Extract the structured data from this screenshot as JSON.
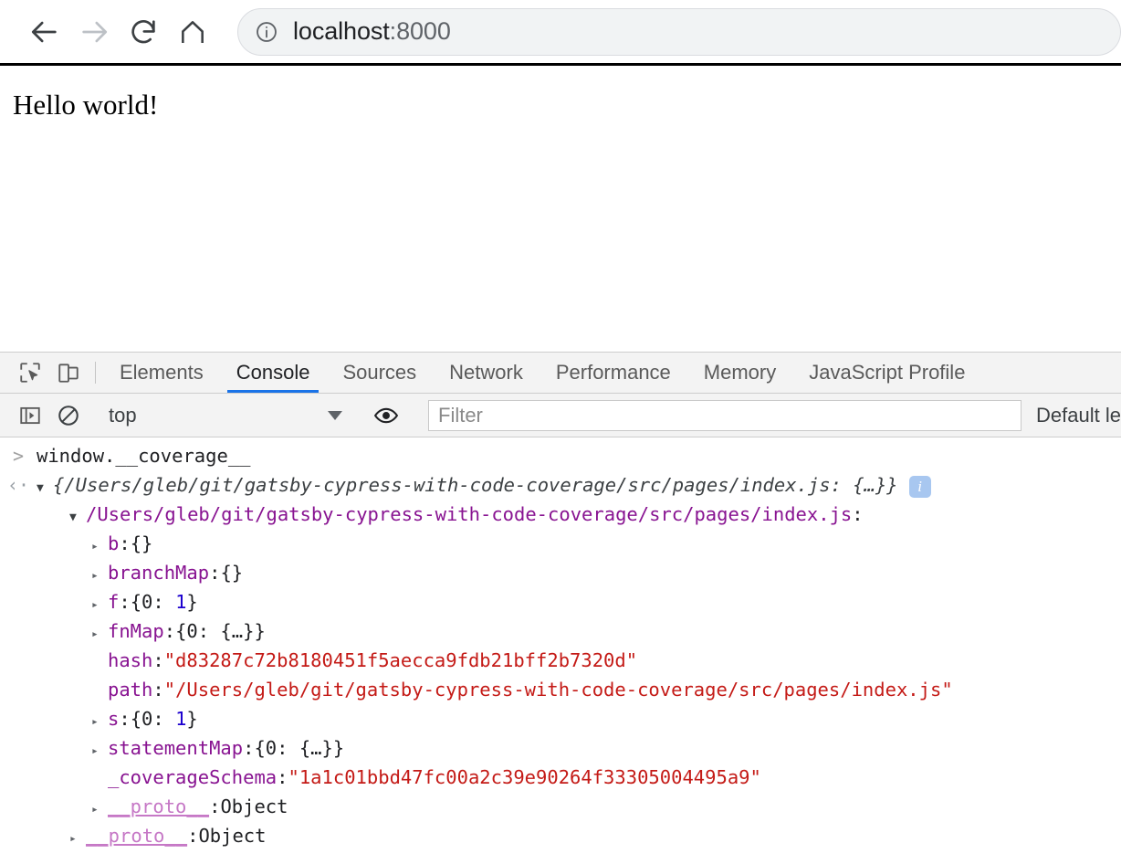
{
  "browser": {
    "nav": {
      "back_icon": "arrow-left-icon",
      "forward_icon": "arrow-right-icon",
      "reload_icon": "reload-icon",
      "home_icon": "home-icon"
    },
    "omnibox": {
      "site_info_icon": "info-circle-icon",
      "url_host": "localhost",
      "url_port": ":8000",
      "value": "localhost:8000"
    }
  },
  "page": {
    "heading": "Hello world!"
  },
  "devtools": {
    "inspect_icon": "inspect-element-icon",
    "device_toolbar_icon": "device-toolbar-icon",
    "tabs": [
      {
        "label": "Elements",
        "active": false
      },
      {
        "label": "Console",
        "active": true
      },
      {
        "label": "Sources",
        "active": false
      },
      {
        "label": "Network",
        "active": false
      },
      {
        "label": "Performance",
        "active": false
      },
      {
        "label": "Memory",
        "active": false
      },
      {
        "label": "JavaScript Profile",
        "active": false
      }
    ],
    "toolbar": {
      "sidebar_icon": "console-sidebar-icon",
      "clear_icon": "clear-console-icon",
      "context": "top",
      "eye_icon": "live-expression-icon",
      "filter_placeholder": "Filter",
      "filter_value": "",
      "levels_label": "Default le"
    },
    "accent_color": "#1a73e8",
    "console": {
      "prompt_symbol": ">",
      "output_symbol": "‹·",
      "input_expression": "window.__coverage__",
      "result_preview": "{/Users/gleb/git/gatsby-cypress-with-code-coverage/src/pages/index.js: {…}}",
      "result_badge": "i",
      "object_key": "/Users/gleb/git/gatsby-cypress-with-code-coverage/src/pages/index.js",
      "properties": [
        {
          "expander": "▸",
          "indent": 3,
          "name": "b",
          "name_class": "tok-key",
          "value": "{}",
          "value_class": "tok-plain"
        },
        {
          "expander": "▸",
          "indent": 3,
          "name": "branchMap",
          "name_class": "tok-key",
          "value": "{}",
          "value_class": "tok-plain"
        },
        {
          "expander": "▸",
          "indent": 3,
          "name": "f",
          "name_class": "tok-key",
          "value": "{0: 1}",
          "value_class": "tok-plain"
        },
        {
          "expander": "▸",
          "indent": 3,
          "name": "fnMap",
          "name_class": "tok-key",
          "value": "{0: {…}}",
          "value_class": "tok-plain"
        },
        {
          "expander": "",
          "indent": 3,
          "name": "hash",
          "name_class": "tok-key",
          "value": "\"d83287c72b8180451f5aecca9fdb21bff2b7320d\"",
          "value_class": "tok-str"
        },
        {
          "expander": "",
          "indent": 3,
          "name": "path",
          "name_class": "tok-key",
          "value": "\"/Users/gleb/git/gatsby-cypress-with-code-coverage/src/pages/index.js\"",
          "value_class": "tok-str"
        },
        {
          "expander": "▸",
          "indent": 3,
          "name": "s",
          "name_class": "tok-key",
          "value": "{0: 1}",
          "value_class": "tok-plain"
        },
        {
          "expander": "▸",
          "indent": 3,
          "name": "statementMap",
          "name_class": "tok-key",
          "value": "{0: {…}}",
          "value_class": "tok-plain"
        },
        {
          "expander": "",
          "indent": 3,
          "name": "_coverageSchema",
          "name_class": "tok-key",
          "value": "\"1a1c01bbd47fc00a2c39e90264f33305004495a9\"",
          "value_class": "tok-str"
        },
        {
          "expander": "▸",
          "indent": 3,
          "name": "__proto__",
          "name_class": "tok-key-proto",
          "value": "Object",
          "value_class": "tok-plain"
        },
        {
          "expander": "▸",
          "indent": 2,
          "name": "__proto__",
          "name_class": "tok-key-proto",
          "value": "Object",
          "value_class": "tok-plain"
        }
      ]
    }
  }
}
